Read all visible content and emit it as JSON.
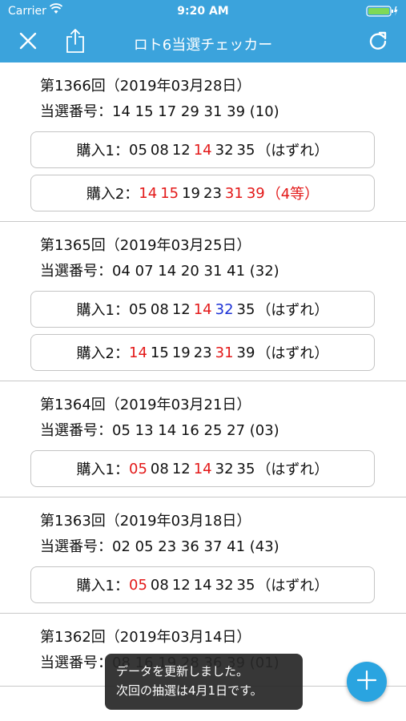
{
  "status_bar": {
    "carrier": "Carrier",
    "time": "9:20 AM"
  },
  "nav": {
    "title": "ロト6当選チェッカー",
    "close_icon": "close-icon",
    "share_icon": "share-icon",
    "refresh_icon": "refresh-icon",
    "bar_color": "#3ba3dc"
  },
  "colors": {
    "hit": "#e31919",
    "bonus": "#1a30d6",
    "accent": "#2aa4e0"
  },
  "draws": [
    {
      "title": "第1366回（2019年03月28日）",
      "winning": "当選番号：14 15 17 29 31 39 (10)",
      "purchases": [
        {
          "label": "購入1：",
          "numbers": [
            {
              "n": "05",
              "s": "miss"
            },
            {
              "n": "08",
              "s": "miss"
            },
            {
              "n": "12",
              "s": "miss"
            },
            {
              "n": "14",
              "s": "hit"
            },
            {
              "n": "32",
              "s": "miss"
            },
            {
              "n": "35",
              "s": "miss"
            }
          ],
          "result": "（はずれ）",
          "win": false
        },
        {
          "label": "購入2：",
          "numbers": [
            {
              "n": "14",
              "s": "hit"
            },
            {
              "n": "15",
              "s": "hit"
            },
            {
              "n": "19",
              "s": "miss"
            },
            {
              "n": "23",
              "s": "miss"
            },
            {
              "n": "31",
              "s": "hit"
            },
            {
              "n": "39",
              "s": "hit"
            }
          ],
          "result": "（4等）",
          "win": true
        }
      ]
    },
    {
      "title": "第1365回（2019年03月25日）",
      "winning": "当選番号：04 07 14 20 31 41 (32)",
      "purchases": [
        {
          "label": "購入1：",
          "numbers": [
            {
              "n": "05",
              "s": "miss"
            },
            {
              "n": "08",
              "s": "miss"
            },
            {
              "n": "12",
              "s": "miss"
            },
            {
              "n": "14",
              "s": "hit"
            },
            {
              "n": "32",
              "s": "bonus"
            },
            {
              "n": "35",
              "s": "miss"
            }
          ],
          "result": "（はずれ）",
          "win": false
        },
        {
          "label": "購入2：",
          "numbers": [
            {
              "n": "14",
              "s": "hit"
            },
            {
              "n": "15",
              "s": "miss"
            },
            {
              "n": "19",
              "s": "miss"
            },
            {
              "n": "23",
              "s": "miss"
            },
            {
              "n": "31",
              "s": "hit"
            },
            {
              "n": "39",
              "s": "miss"
            }
          ],
          "result": "（はずれ）",
          "win": false
        }
      ]
    },
    {
      "title": "第1364回（2019年03月21日）",
      "winning": "当選番号：05 13 14 16 25 27 (03)",
      "purchases": [
        {
          "label": "購入1：",
          "numbers": [
            {
              "n": "05",
              "s": "hit"
            },
            {
              "n": "08",
              "s": "miss"
            },
            {
              "n": "12",
              "s": "miss"
            },
            {
              "n": "14",
              "s": "hit"
            },
            {
              "n": "32",
              "s": "miss"
            },
            {
              "n": "35",
              "s": "miss"
            }
          ],
          "result": "（はずれ）",
          "win": false
        }
      ]
    },
    {
      "title": "第1363回（2019年03月18日）",
      "winning": "当選番号：02 05 23 36 37 41 (43)",
      "purchases": [
        {
          "label": "購入1：",
          "numbers": [
            {
              "n": "05",
              "s": "hit"
            },
            {
              "n": "08",
              "s": "miss"
            },
            {
              "n": "12",
              "s": "miss"
            },
            {
              "n": "14",
              "s": "miss"
            },
            {
              "n": "32",
              "s": "miss"
            },
            {
              "n": "35",
              "s": "miss"
            }
          ],
          "result": "（はずれ）",
          "win": false
        }
      ]
    },
    {
      "title": "第1362回（2019年03月14日）",
      "winning": "当選番号：08 16 19 28 36 39 (01)",
      "purchases": []
    }
  ],
  "toast": {
    "line1": "データを更新しました。",
    "line2": "次回の抽選は4月1日です。"
  },
  "fab": {
    "icon": "plus-icon"
  }
}
